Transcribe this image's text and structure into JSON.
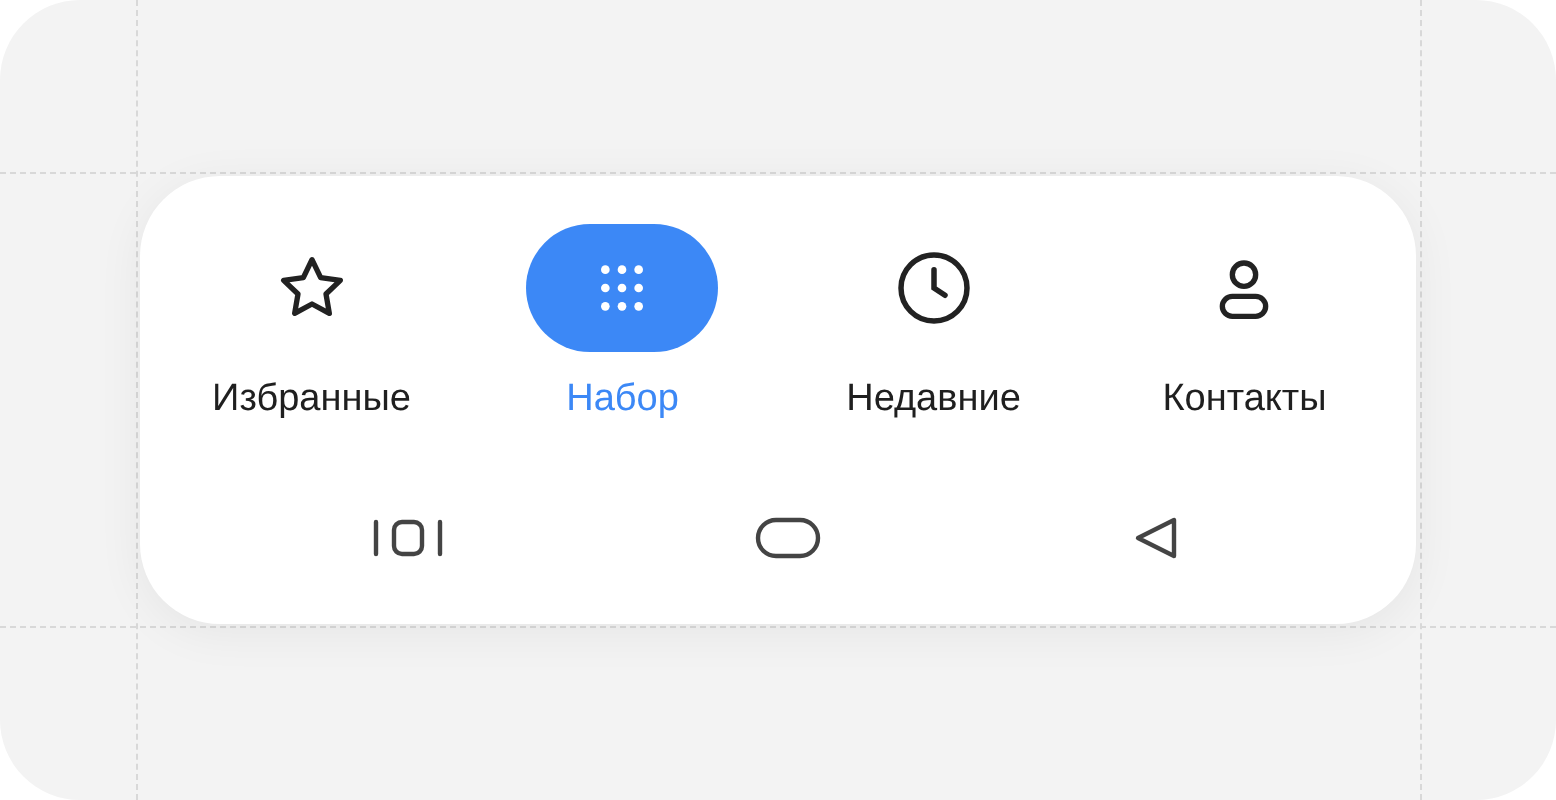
{
  "tabs": [
    {
      "label": "Избранные",
      "selected": false
    },
    {
      "label": "Набор",
      "selected": true
    },
    {
      "label": "Недавние",
      "selected": false
    },
    {
      "label": "Контакты",
      "selected": false
    }
  ]
}
